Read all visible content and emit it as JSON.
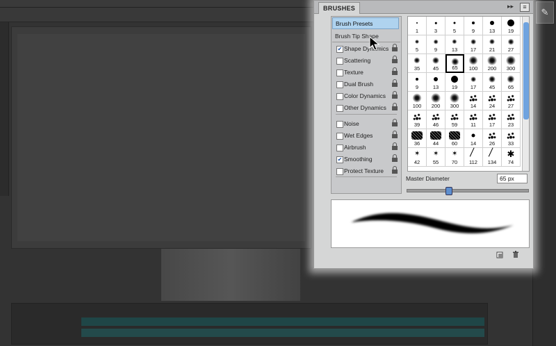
{
  "panel": {
    "tab_label": "BRUSHES",
    "menu_glyph": "▸▸"
  },
  "options": {
    "brush_presets": "Brush Presets",
    "brush_tip_shape": "Brush Tip Shape",
    "items": [
      {
        "label": "Shape Dynamics",
        "checked": true
      },
      {
        "label": "Scattering",
        "checked": false
      },
      {
        "label": "Texture",
        "checked": false
      },
      {
        "label": "Dual Brush",
        "checked": false
      },
      {
        "label": "Color Dynamics",
        "checked": false
      },
      {
        "label": "Other Dynamics",
        "checked": false
      },
      {
        "label": "Noise",
        "checked": false
      },
      {
        "label": "Wet Edges",
        "checked": false
      },
      {
        "label": "Airbrush",
        "checked": false
      },
      {
        "label": "Smoothing",
        "checked": true
      },
      {
        "label": "Protect Texture",
        "checked": false
      }
    ]
  },
  "brush_grid": {
    "selected": "65",
    "rows": [
      [
        {
          "n": "1",
          "k": "hard"
        },
        {
          "n": "3",
          "k": "hard"
        },
        {
          "n": "5",
          "k": "hard"
        },
        {
          "n": "9",
          "k": "hard"
        },
        {
          "n": "13",
          "k": "hard"
        },
        {
          "n": "19",
          "k": "hard"
        }
      ],
      [
        {
          "n": "5",
          "k": "soft"
        },
        {
          "n": "9",
          "k": "soft"
        },
        {
          "n": "13",
          "k": "soft"
        },
        {
          "n": "17",
          "k": "soft"
        },
        {
          "n": "21",
          "k": "soft"
        },
        {
          "n": "27",
          "k": "soft"
        }
      ],
      [
        {
          "n": "35",
          "k": "soft"
        },
        {
          "n": "45",
          "k": "soft"
        },
        {
          "n": "65",
          "k": "soft"
        },
        {
          "n": "100",
          "k": "soft"
        },
        {
          "n": "200",
          "k": "soft"
        },
        {
          "n": "300",
          "k": "soft"
        }
      ],
      [
        {
          "n": "9",
          "k": "hard"
        },
        {
          "n": "13",
          "k": "hard"
        },
        {
          "n": "19",
          "k": "hard"
        },
        {
          "n": "17",
          "k": "soft"
        },
        {
          "n": "45",
          "k": "soft"
        },
        {
          "n": "65",
          "k": "soft"
        }
      ],
      [
        {
          "n": "100",
          "k": "soft"
        },
        {
          "n": "200",
          "k": "soft"
        },
        {
          "n": "300",
          "k": "soft"
        },
        {
          "n": "14",
          "k": "spatter"
        },
        {
          "n": "24",
          "k": "spatter"
        },
        {
          "n": "27",
          "k": "spatter"
        }
      ],
      [
        {
          "n": "39",
          "k": "spatter"
        },
        {
          "n": "46",
          "k": "spatter"
        },
        {
          "n": "59",
          "k": "spatter"
        },
        {
          "n": "11",
          "k": "spatter"
        },
        {
          "n": "17",
          "k": "spatter"
        },
        {
          "n": "23",
          "k": "spatter"
        }
      ],
      [
        {
          "n": "36",
          "k": "chalk"
        },
        {
          "n": "44",
          "k": "chalk"
        },
        {
          "n": "60",
          "k": "chalk"
        },
        {
          "n": "14",
          "k": "hard"
        },
        {
          "n": "26",
          "k": "spatter"
        },
        {
          "n": "33",
          "k": "spatter"
        }
      ],
      [
        {
          "n": "42",
          "k": "star"
        },
        {
          "n": "55",
          "k": "star"
        },
        {
          "n": "70",
          "k": "star"
        },
        {
          "n": "112",
          "k": "grass"
        },
        {
          "n": "134",
          "k": "grass"
        },
        {
          "n": "74",
          "k": "leaf"
        }
      ]
    ]
  },
  "master_diameter": {
    "label": "Master Diameter",
    "value": "65 px",
    "slider_fraction": 0.33
  },
  "icons": {
    "new_preset": "new-preset-icon",
    "delete": "trash-icon",
    "cursor": "mouse-cursor-icon"
  }
}
